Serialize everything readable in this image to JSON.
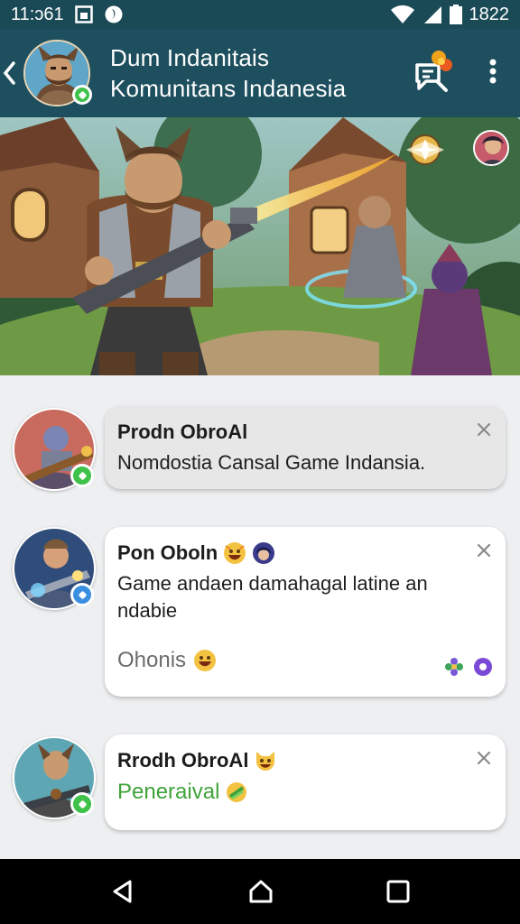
{
  "status_bar": {
    "time": "11:ɔ61",
    "battery": "1822",
    "icons": [
      "gallery-icon",
      "data-saver-icon",
      "wifi-icon",
      "signal-icon",
      "battery-icon"
    ]
  },
  "header": {
    "title_line1": "Dum Indanitais",
    "title_line2": "Komunitans Indanesia",
    "icons": [
      "back-icon",
      "chat-notification-icon",
      "more-vert-icon"
    ],
    "accent": "#1e4f5e"
  },
  "messages": [
    {
      "name": "Prodn ObroAl",
      "text": "Nomdostia Cansal Game Indansia.",
      "status_color": "#3ec24a"
    },
    {
      "name": "Pon Oboln",
      "text": "Game andaen damahagal latine an ndabie",
      "subtext": "Ohonis",
      "status_color": "#3a8fe0"
    },
    {
      "name": "Rrodh ObroAl",
      "text": "Peneraival",
      "text_color": "#3fa33a",
      "status_color": "#3ec24a"
    }
  ],
  "nav": {
    "icons": [
      "nav-back-icon",
      "nav-home-icon",
      "nav-recents-icon"
    ]
  }
}
